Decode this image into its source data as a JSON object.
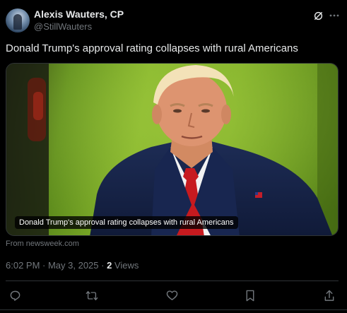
{
  "author": {
    "display_name": "Alexis Wauters, CP",
    "handle": "@StillWauters",
    "avatar_icon": "avatar-image"
  },
  "post": {
    "text": "Donald Trump's approval rating collapses with rural Americans"
  },
  "media": {
    "caption": "Donald Trump's approval rating collapses with rural Americans",
    "source": "From newsweek.com"
  },
  "meta": {
    "timestamp": "6:02 PM · May 3, 2025 · ",
    "views_count": "2",
    "views_label": " Views"
  },
  "header_icons": {
    "grok": "grok-icon",
    "more": "more-icon"
  },
  "actions": {
    "reply": "reply-icon",
    "repost": "repost-icon",
    "like": "like-icon",
    "bookmark": "bookmark-icon",
    "share": "share-icon"
  },
  "colors": {
    "background": "#000000",
    "text_primary": "#e7e9ea",
    "text_secondary": "#71767b",
    "border": "#2f3336",
    "icon": "#71767b"
  }
}
